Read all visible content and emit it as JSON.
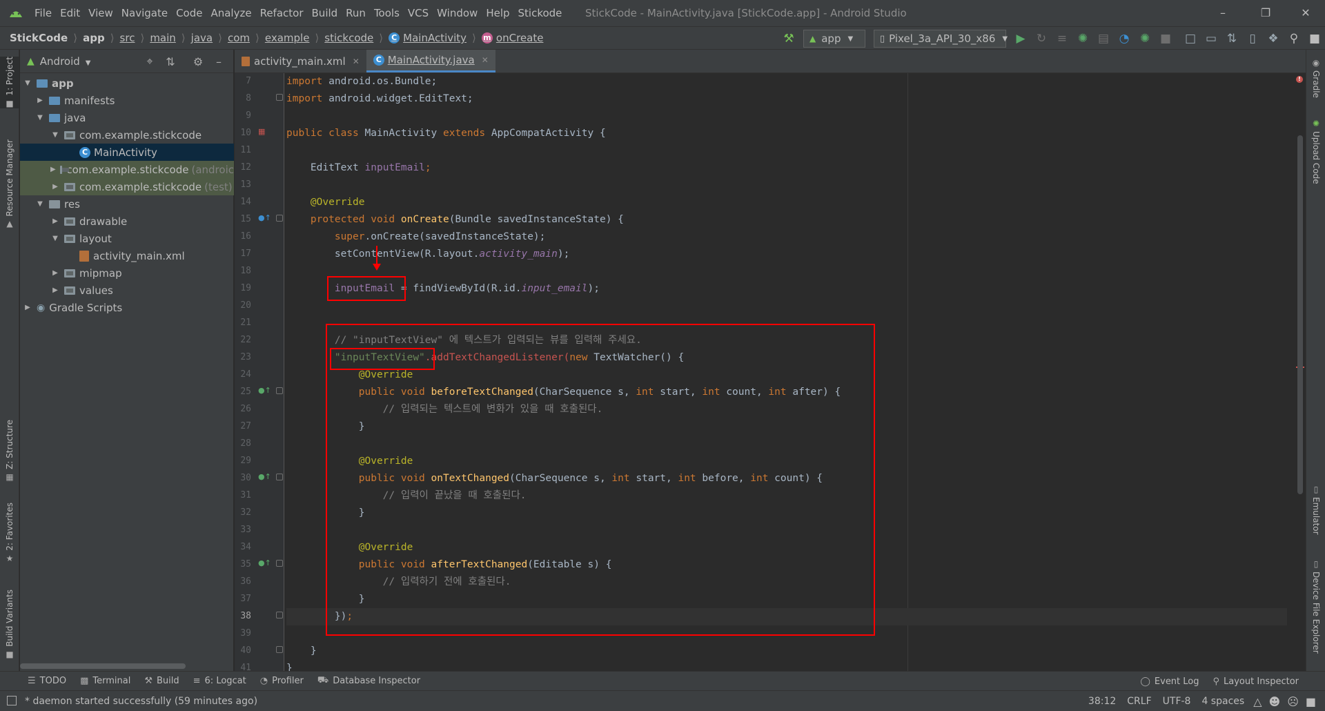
{
  "menu": {
    "items": [
      {
        "label": "File"
      },
      {
        "label": "Edit"
      },
      {
        "label": "View"
      },
      {
        "label": "Navigate"
      },
      {
        "label": "Code"
      },
      {
        "label": "Analyze"
      },
      {
        "label": "Refactor"
      },
      {
        "label": "Build"
      },
      {
        "label": "Run"
      },
      {
        "label": "Tools"
      },
      {
        "label": "VCS"
      },
      {
        "label": "Window"
      },
      {
        "label": "Help"
      },
      {
        "label": "Stickode"
      }
    ],
    "window_title": "StickCode - MainActivity.java [StickCode.app] - Android Studio"
  },
  "breadcrumb": {
    "items": [
      "StickCode",
      "app",
      "src",
      "main",
      "java",
      "com",
      "example",
      "stickcode",
      "MainActivity",
      "onCreate"
    ]
  },
  "toolbar": {
    "run_config": "app",
    "device": "Pixel_3a_API_30_x86"
  },
  "left_strip": {
    "project": "1: Project",
    "resource_manager": "Resource Manager",
    "structure": "Z: Structure",
    "favorites": "2: Favorites",
    "build_variants": "Build Variants"
  },
  "right_strip": {
    "gradle": "Gradle",
    "upload_code": "Upload Code",
    "emulator": "Emulator",
    "device_file_explorer": "Device File Explorer"
  },
  "project_panel": {
    "view": "Android",
    "tree": [
      {
        "label": "app"
      },
      {
        "label": "manifests"
      },
      {
        "label": "java"
      },
      {
        "label": "com.example.stickcode"
      },
      {
        "label": "MainActivity"
      },
      {
        "label": "com.example.stickcode",
        "suffix": "(androic"
      },
      {
        "label": "com.example.stickcode",
        "suffix": "(test)"
      },
      {
        "label": "res"
      },
      {
        "label": "drawable"
      },
      {
        "label": "layout"
      },
      {
        "label": "activity_main.xml"
      },
      {
        "label": "mipmap"
      },
      {
        "label": "values"
      },
      {
        "label": "Gradle Scripts"
      }
    ]
  },
  "editor": {
    "tabs": [
      {
        "label": "activity_main.xml"
      },
      {
        "label": "MainActivity.java"
      }
    ],
    "line_numbers": [
      "7",
      "8",
      "9",
      "10",
      "11",
      "12",
      "13",
      "14",
      "15",
      "16",
      "17",
      "18",
      "19",
      "20",
      "21",
      "22",
      "23",
      "24",
      "25",
      "26",
      "27",
      "28",
      "29",
      "30",
      "31",
      "32",
      "33",
      "34",
      "35",
      "36",
      "37",
      "38",
      "39",
      "40",
      "41"
    ],
    "code": {
      "l7_kw": "import",
      "l7_rest": " android.os.Bundle;",
      "l8_kw": "import",
      "l8_rest": " android.widget.EditText;",
      "l10_a": "public class",
      "l10_b": " MainActivity ",
      "l10_c": "extends",
      "l10_d": " AppCompatActivity {",
      "l12_a": "    EditText ",
      "l12_b": "inputEmail",
      "l12_c": ";",
      "l14": "    @Override",
      "l15_a": "    protected void ",
      "l15_b": "onCreate",
      "l15_c": "(Bundle savedInstanceState) {",
      "l16_a": "        super",
      "l16_b": ".onCreate(savedInstanceState);",
      "l17_a": "        setContentView(R.layout.",
      "l17_b": "activity_main",
      "l17_c": ");",
      "l19_a": "        inputEmail",
      "l19_b": " = findViewById(R.id.",
      "l19_c": "input_email",
      "l19_d": ");",
      "l22": "        // \"inputTextView\" 에 텍스트가 입력되는 뷰를 입력해 주세요.",
      "l23_a": "        \"inputTextView\"",
      "l23_b": ".addTextChangedListener(",
      "l23_c": "new",
      "l23_d": " TextWatcher() {",
      "l24": "            @Override",
      "l25_a": "            public void ",
      "l25_b": "beforeTextChanged",
      "l25_c": "(CharSequence s, ",
      "l25_d": "int",
      "l25_e": " start, ",
      "l25_f": "int",
      "l25_g": " count, ",
      "l25_h": "int",
      "l25_i": " after) {",
      "l26": "                // 입력되는 텍스트에 변화가 있을 때 호출된다.",
      "l27": "            }",
      "l29": "            @Override",
      "l30_a": "            public void ",
      "l30_b": "onTextChanged",
      "l30_c": "(CharSequence s, ",
      "l30_d": "int",
      "l30_e": " start, ",
      "l30_f": "int",
      "l30_g": " before, ",
      "l30_h": "int",
      "l30_i": " count) {",
      "l31": "                // 입력이 끝났을 때 호출된다.",
      "l32": "            }",
      "l34": "            @Override",
      "l35_a": "            public void ",
      "l35_b": "afterTextChanged",
      "l35_c": "(Editable s) {",
      "l36": "                // 입력하기 전에 호출된다.",
      "l37": "            }",
      "l38_a": "        })",
      "l38_b": ";",
      "l40": "    }",
      "l41": "}"
    }
  },
  "tool_windows": {
    "todo": "TODO",
    "terminal": "Terminal",
    "build": "Build",
    "logcat": "6: Logcat",
    "profiler": "Profiler",
    "database_inspector": "Database Inspector",
    "event_log": "Event Log",
    "layout_inspector": "Layout Inspector"
  },
  "status_bar": {
    "message": "* daemon started successfully (59 minutes ago)",
    "position": "38:12",
    "line_sep": "CRLF",
    "encoding": "UTF-8",
    "indent": "4 spaces"
  },
  "colors": {
    "background": "#2b2b2b",
    "panel": "#3c3f41",
    "keyword": "#cc7832",
    "field": "#9876aa",
    "annotation": "#bbb529",
    "method": "#ffc66d",
    "string": "#6a8759",
    "comment": "#808080",
    "annotation_box": "#ff0000"
  }
}
